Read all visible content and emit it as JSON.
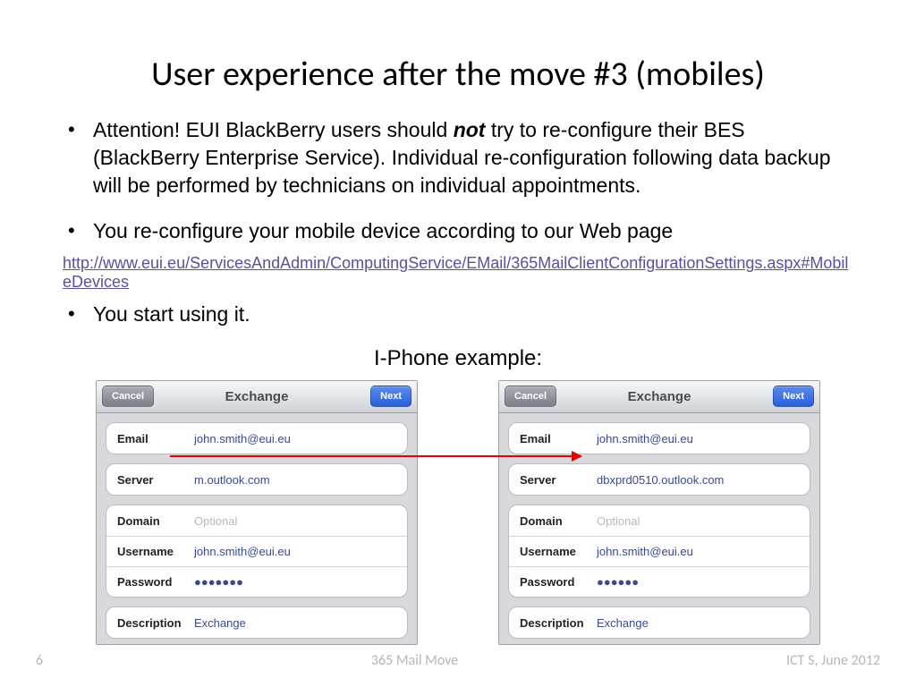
{
  "title": "User experience after the move #3 (mobiles)",
  "bullets": {
    "b1_pre": "Attention! EUI BlackBerry users should ",
    "b1_em": "not",
    "b1_post": " try to re-configure their BES (BlackBerry Enterprise Service). Individual re-configuration following data backup will be performed by technicians on individual appointments.",
    "b2": "You re-configure your mobile device according to our Web page",
    "b3": "You start using it."
  },
  "link": "http://www.eui.eu/ServicesAndAdmin/ComputingService/EMail/365MailClientConfigurationSettings.aspx#MobileDevices",
  "example_label": "I-Phone example:",
  "phone_left": {
    "header": "Exchange",
    "cancel": "Cancel",
    "next": "Next",
    "email_lbl": "Email",
    "email_val": "john.smith@eui.eu",
    "server_lbl": "Server",
    "server_val": "m.outlook.com",
    "domain_lbl": "Domain",
    "domain_val": "Optional",
    "user_lbl": "Username",
    "user_val": "john.smith@eui.eu",
    "pass_lbl": "Password",
    "pass_val": "●●●●●●●",
    "desc_lbl": "Description",
    "desc_val": "Exchange"
  },
  "phone_right": {
    "header": "Exchange",
    "cancel": "Cancel",
    "next": "Next",
    "email_lbl": "Email",
    "email_val": "john.smith@eui.eu",
    "server_lbl": "Server",
    "server_val": "dbxprd0510.outlook.com",
    "domain_lbl": "Domain",
    "domain_val": "Optional",
    "user_lbl": "Username",
    "user_val": "john.smith@eui.eu",
    "pass_lbl": "Password",
    "pass_val": "●●●●●●",
    "desc_lbl": "Description",
    "desc_val": "Exchange"
  },
  "footer": {
    "left": "6",
    "center": "365 Mail Move",
    "right": "ICT S, June 2012"
  }
}
